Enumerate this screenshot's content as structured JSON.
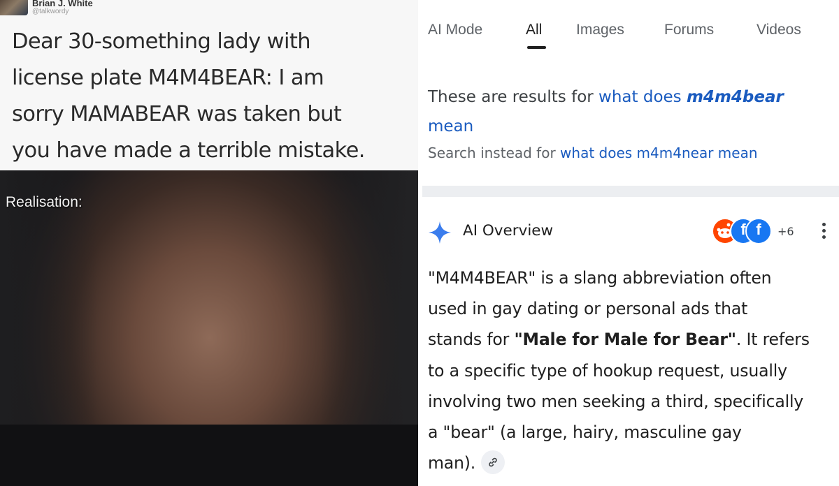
{
  "tweet": {
    "author": "Brian J. White",
    "handle": "@talkwordy",
    "lines": [
      "Dear 30-something lady with",
      "license plate M4M4BEAR: I am",
      "sorry MAMABEAR was taken but",
      "you have made a terrible mistake."
    ],
    "image_caption": "Realisation:"
  },
  "search": {
    "tabs": [
      "AI Mode",
      "All",
      "Images",
      "Forums",
      "Videos"
    ],
    "active_tab": "All",
    "results_prefix": "These are results for",
    "results_query_pre": "what does",
    "results_query_bold": "m4m4bear",
    "results_query_post": "mean",
    "instead_prefix": "Search instead for",
    "instead_query": "what does m4m4near mean"
  },
  "ai_overview": {
    "title": "AI Overview",
    "sources_extra": "+6",
    "source_icons": [
      "reddit-icon",
      "facebook-icon",
      "facebook-icon"
    ],
    "body_lines": [
      "\"M4M4BEAR\" is a slang abbreviation often",
      "used in gay dating or personal ads that",
      "stands for ",
      "to a specific type of hookup request, usually",
      "involving two men seeking a third, specifically",
      "a \"bear\" (a large, hairy, masculine gay",
      "man)."
    ],
    "bold_phrase": "\"Male for Male for Bear\"",
    "after_bold": ". It refers"
  },
  "colors": {
    "link_blue": "#1a5bbf",
    "ai_star_blue": "#3b7ded",
    "reddit_orange": "#ff4500",
    "facebook_blue": "#1877f2",
    "divider_gray": "#eceef1"
  }
}
